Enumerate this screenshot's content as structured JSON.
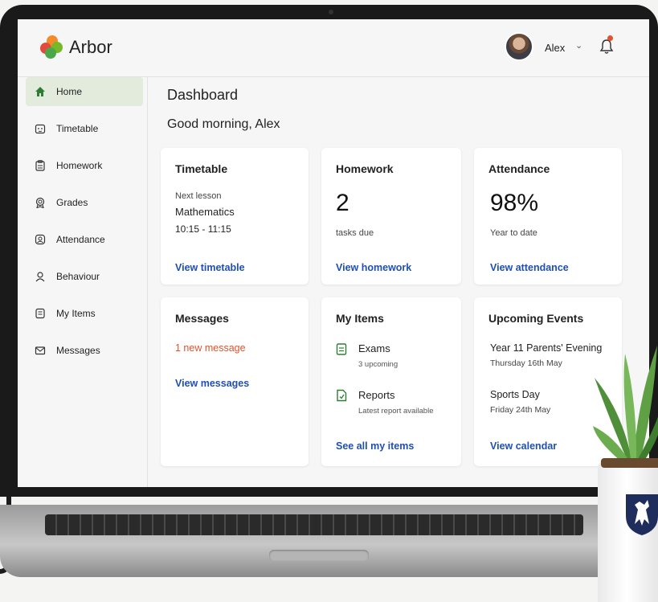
{
  "brand": {
    "name": "Arbor"
  },
  "header": {
    "user_name": "Alex",
    "caret": "⌄"
  },
  "sidebar": {
    "items": [
      {
        "label": "Home",
        "icon": "home-icon",
        "active": true
      },
      {
        "label": "Timetable",
        "icon": "calendar-icon"
      },
      {
        "label": "Homework",
        "icon": "clipboard-icon"
      },
      {
        "label": "Grades",
        "icon": "award-icon"
      },
      {
        "label": "Attendance",
        "icon": "attendance-icon"
      },
      {
        "label": "Behaviour",
        "icon": "people-icon"
      },
      {
        "label": "My Items",
        "icon": "items-icon"
      },
      {
        "label": "Messages",
        "icon": "mail-icon"
      }
    ]
  },
  "main": {
    "title": "Dashboard",
    "greeting": "Good morning, Alex",
    "timetable": {
      "title": "Timetable",
      "next_label": "Next lesson",
      "subject": "Mathematics",
      "time": "10:15 - 11:15",
      "link": "View timetable"
    },
    "homework": {
      "title": "Homework",
      "count": "2",
      "caption": "tasks due",
      "link": "View homework"
    },
    "attendance": {
      "title": "Attendance",
      "value": "98%",
      "caption": "Year to date",
      "link": "View attendance"
    },
    "messages": {
      "title": "Messages",
      "new": "1 new message",
      "link": "View messages"
    },
    "my_items": {
      "title": "My Items",
      "items": [
        {
          "label": "Exams",
          "sub": "3 upcoming"
        },
        {
          "label": "Reports",
          "sub": "Latest report available"
        }
      ],
      "link": "See all my items"
    },
    "events": {
      "title": "Upcoming Events",
      "items": [
        {
          "label": "Year 11 Parents' Evening",
          "date": "Thursday 16th May"
        },
        {
          "label": "Sports Day",
          "date": "Friday 24th May"
        }
      ],
      "link": "View calendar"
    }
  },
  "colors": {
    "accent_green": "#2e7d32",
    "active_bg": "#e3ecdc",
    "link_blue": "#1f4fb5",
    "alert_orange": "#e2522d"
  }
}
